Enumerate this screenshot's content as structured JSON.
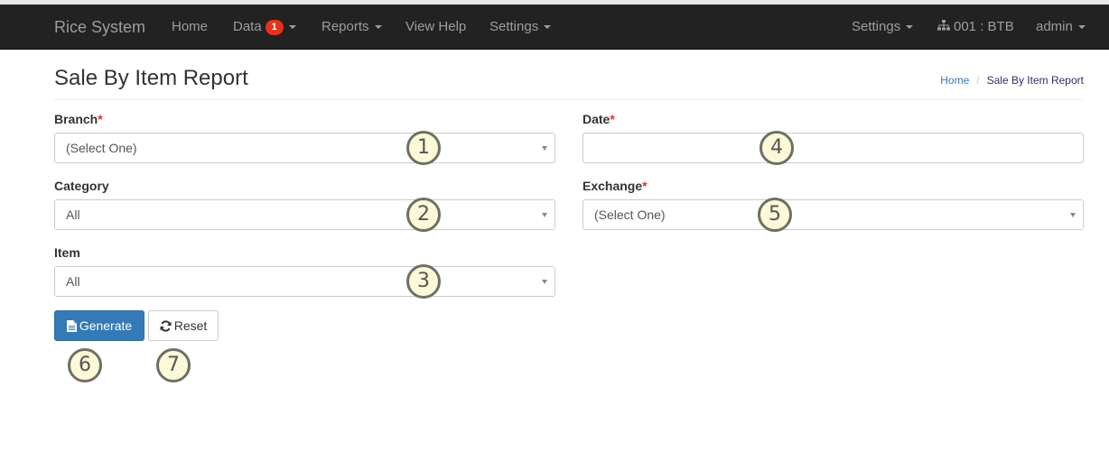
{
  "navbar": {
    "brand": "Rice System",
    "items": [
      {
        "label": "Home"
      },
      {
        "label": "Data",
        "badge": "1"
      },
      {
        "label": "Reports"
      },
      {
        "label": "View Help"
      },
      {
        "label": "Settings"
      }
    ],
    "right": {
      "settings": "Settings",
      "branch": "001 : BTB",
      "user": "admin"
    }
  },
  "page": {
    "title": "Sale By Item Report",
    "breadcrumb": {
      "home": "Home",
      "current": "Sale By Item Report"
    }
  },
  "form": {
    "branch": {
      "label": "Branch",
      "required": "*",
      "value": "(Select One)"
    },
    "category": {
      "label": "Category",
      "value": "All"
    },
    "item": {
      "label": "Item",
      "value": "All"
    },
    "date": {
      "label": "Date",
      "required": "*",
      "value": ""
    },
    "exchange": {
      "label": "Exchange",
      "required": "*",
      "value": "(Select One)"
    }
  },
  "buttons": {
    "generate": "Generate",
    "reset": "Reset"
  },
  "markers": [
    "1",
    "2",
    "3",
    "4",
    "5",
    "6",
    "7"
  ],
  "colors": {
    "navbar": "#222222",
    "primary": "#337ab7",
    "badge": "#e8311c",
    "required": "#e52d2d"
  }
}
